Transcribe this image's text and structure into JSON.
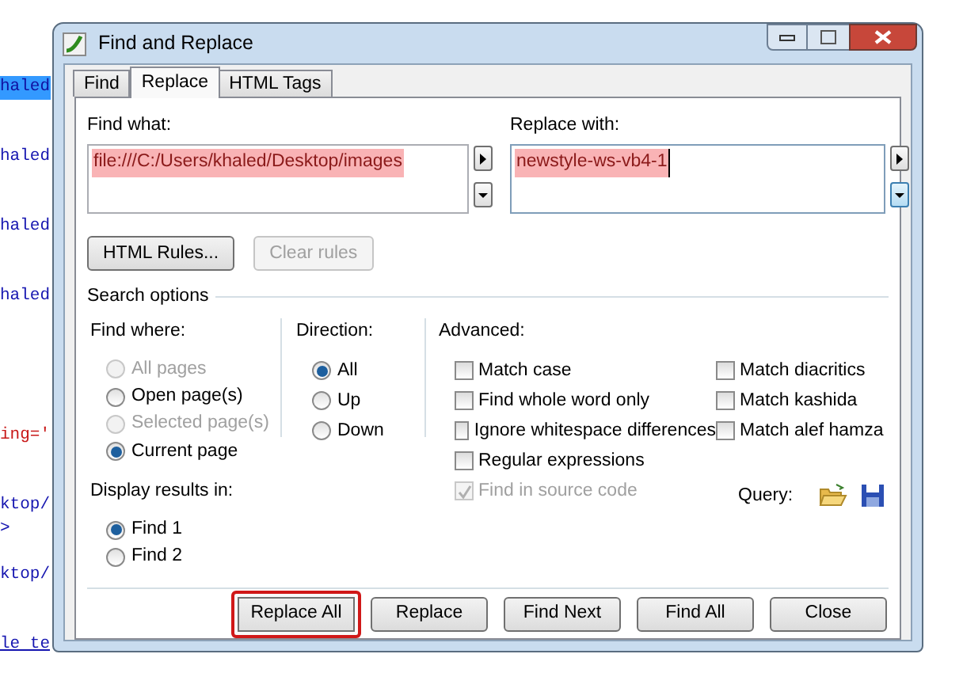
{
  "editor_lines": [
    {
      "text": "haled",
      "kind": "selected"
    },
    {
      "text": "haled",
      "kind": "plain"
    },
    {
      "text": "haled",
      "kind": "plain"
    },
    {
      "text": "haled",
      "kind": "plain"
    },
    {
      "kind": "gap"
    },
    {
      "text": "ing='",
      "kind": "attr"
    },
    {
      "text": "ktop/",
      "kind": "plain"
    },
    {
      "text": ">",
      "kind": "plain"
    },
    {
      "text": "ktop/",
      "kind": "plain"
    },
    {
      "text": "le te",
      "kind": "link"
    }
  ],
  "window": {
    "title": "Find and Replace"
  },
  "tabs": [
    {
      "label": "Find",
      "selected": false
    },
    {
      "label": "Replace",
      "selected": true
    },
    {
      "label": "HTML Tags",
      "selected": false
    }
  ],
  "find_what": {
    "label": "Find what:",
    "value": "file:///C:/Users/khaled/Desktop/images",
    "highlighted": true,
    "focused": false
  },
  "replace_with": {
    "label": "Replace with:",
    "value": "newstyle-ws-vb4-1",
    "highlighted": true,
    "focused": true
  },
  "rule_buttons": [
    {
      "label": "HTML Rules...",
      "disabled": false
    },
    {
      "label": "Clear rules",
      "disabled": true
    }
  ],
  "search_options": {
    "label": "Search options"
  },
  "find_where": {
    "label": "Find where:",
    "options": [
      {
        "label": "All pages",
        "selected": false,
        "disabled": true
      },
      {
        "label": "Open page(s)",
        "selected": false,
        "disabled": false
      },
      {
        "label": "Selected page(s)",
        "selected": false,
        "disabled": true
      },
      {
        "label": "Current page",
        "selected": true,
        "disabled": false
      }
    ]
  },
  "direction": {
    "label": "Direction:",
    "options": [
      {
        "label": "All",
        "selected": true,
        "disabled": false
      },
      {
        "label": "Up",
        "selected": false,
        "disabled": false
      },
      {
        "label": "Down",
        "selected": false,
        "disabled": false
      }
    ]
  },
  "display_results": {
    "label": "Display results in:",
    "options": [
      {
        "label": "Find 1",
        "selected": true,
        "disabled": false
      },
      {
        "label": "Find 2",
        "selected": false,
        "disabled": false
      }
    ]
  },
  "advanced": {
    "label": "Advanced:",
    "columns": [
      [
        {
          "label": "Match case",
          "checked": false,
          "disabled": false
        },
        {
          "label": "Find whole word only",
          "checked": false,
          "disabled": false
        },
        {
          "label": "Ignore whitespace differences",
          "checked": false,
          "disabled": false
        },
        {
          "label": "Regular expressions",
          "checked": false,
          "disabled": false
        },
        {
          "label": "Find in source code",
          "checked": true,
          "disabled": true
        }
      ],
      [
        {
          "label": "Match diacritics",
          "checked": false,
          "disabled": false
        },
        {
          "label": "Match kashida",
          "checked": false,
          "disabled": false
        },
        {
          "label": "Match alef hamza",
          "checked": false,
          "disabled": false
        }
      ]
    ]
  },
  "query": {
    "label": "Query:"
  },
  "action_buttons": [
    {
      "label": "Replace All",
      "outlined": true
    },
    {
      "label": "Replace",
      "outlined": false
    },
    {
      "label": "Find Next",
      "outlined": false
    },
    {
      "label": "Find All",
      "outlined": false
    },
    {
      "label": "Close",
      "outlined": false
    }
  ]
}
